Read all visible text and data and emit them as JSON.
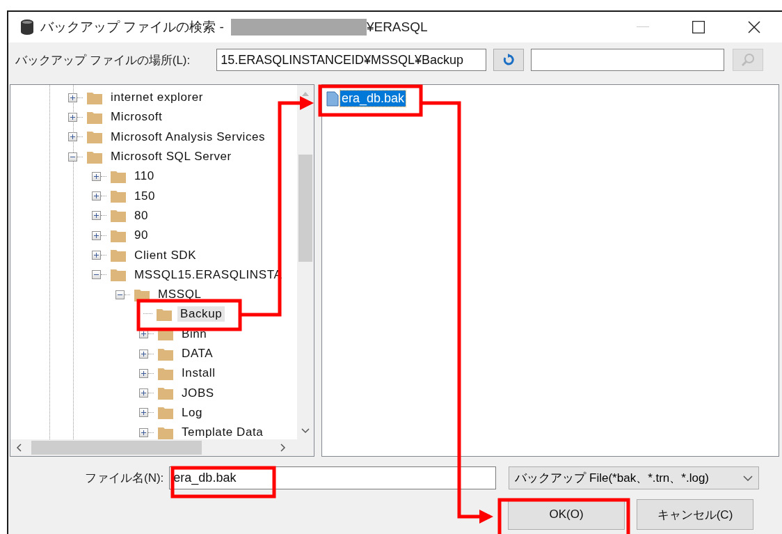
{
  "window": {
    "title": "バックアップ ファイルの検索 - ",
    "title_suffix": "¥ERASQL"
  },
  "location": {
    "label": "バックアップ ファイルの場所(L):",
    "value": "15.ERASQLINSTANCEID¥MSSQL¥Backup"
  },
  "tree": [
    {
      "label": "internet explorer",
      "expanded": false,
      "has_children": true,
      "selected": false
    },
    {
      "label": "Microsoft",
      "expanded": false,
      "has_children": true,
      "selected": false
    },
    {
      "label": "Microsoft Analysis Services",
      "expanded": false,
      "has_children": true,
      "selected": false
    },
    {
      "label": "Microsoft SQL Server",
      "expanded": true,
      "has_children": true,
      "selected": false,
      "children": [
        {
          "label": "110",
          "expanded": false,
          "has_children": true,
          "selected": false
        },
        {
          "label": "150",
          "expanded": false,
          "has_children": true,
          "selected": false
        },
        {
          "label": "80",
          "expanded": false,
          "has_children": true,
          "selected": false
        },
        {
          "label": "90",
          "expanded": false,
          "has_children": true,
          "selected": false
        },
        {
          "label": "Client SDK",
          "expanded": false,
          "has_children": true,
          "selected": false
        },
        {
          "label": "MSSQL15.ERASQLINSTA",
          "expanded": true,
          "has_children": true,
          "selected": false,
          "children": [
            {
              "label": "MSSQL",
              "expanded": true,
              "has_children": true,
              "selected": false,
              "children": [
                {
                  "label": "Backup",
                  "has_children": false,
                  "selected": true
                },
                {
                  "label": "Binn",
                  "expanded": false,
                  "has_children": true,
                  "selected": false
                },
                {
                  "label": "DATA",
                  "expanded": false,
                  "has_children": true,
                  "selected": false
                },
                {
                  "label": "Install",
                  "expanded": false,
                  "has_children": true,
                  "selected": false
                },
                {
                  "label": "JOBS",
                  "expanded": false,
                  "has_children": true,
                  "selected": false
                },
                {
                  "label": "Log",
                  "expanded": false,
                  "has_children": true,
                  "selected": false
                },
                {
                  "label": "Template Data",
                  "expanded": false,
                  "has_children": true,
                  "selected": false
                }
              ]
            }
          ]
        }
      ]
    }
  ],
  "files": [
    {
      "name": "era_db.bak",
      "selected": true
    }
  ],
  "file_name": {
    "label": "ファイル名(N):",
    "value": "era_db.bak"
  },
  "file_type": {
    "value": "バックアップ File(*bak、*.trn、*.log)"
  },
  "buttons": [
    {
      "label": "OK(O)"
    },
    {
      "label": "キャンセル(C)"
    }
  ]
}
